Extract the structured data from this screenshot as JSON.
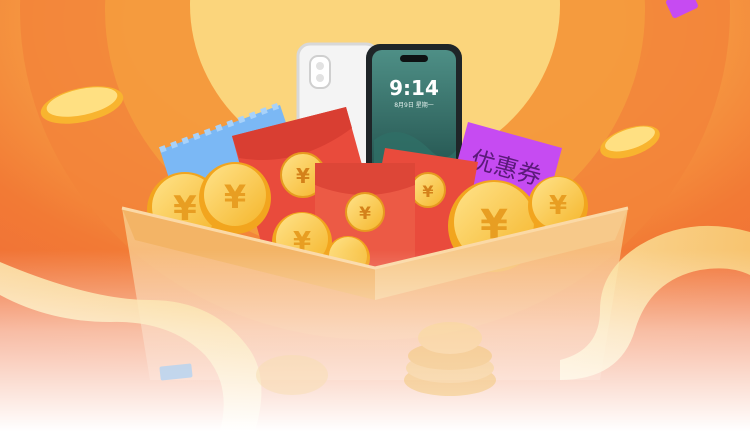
{
  "phone": {
    "time": "9:14",
    "date": "8月9日 星期一"
  },
  "coupon": {
    "label": "优惠券"
  },
  "coin_symbol": "¥",
  "colors": {
    "burst_outer": "#F26A2E",
    "burst_mid": "#F59A3A",
    "burst_inner": "#FBD67E",
    "box": "#F6BE73",
    "red_packet": "#E94B3C",
    "coin": "#FBCB3F",
    "coupon_purple": "#C64BF2",
    "ticket_blue": "#7BB8F5"
  }
}
